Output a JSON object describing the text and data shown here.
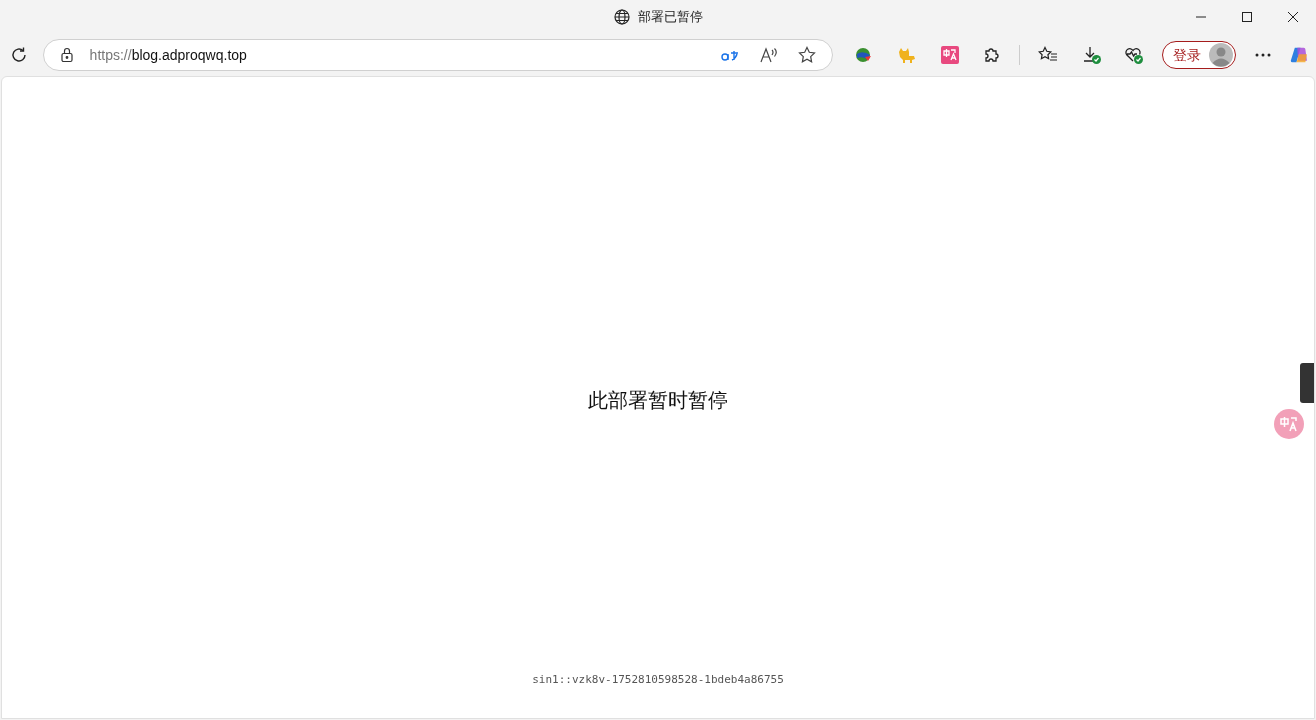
{
  "window": {
    "title": "部署已暂停"
  },
  "address_bar": {
    "scheme": "https://",
    "host": "blog.adproqwq.top"
  },
  "profile": {
    "sign_in_label": "登录"
  },
  "page": {
    "message": "此部署暂时暂停",
    "deployment_id": "sin1::vzk8v-1752810598528-1bdeb4a86755"
  }
}
